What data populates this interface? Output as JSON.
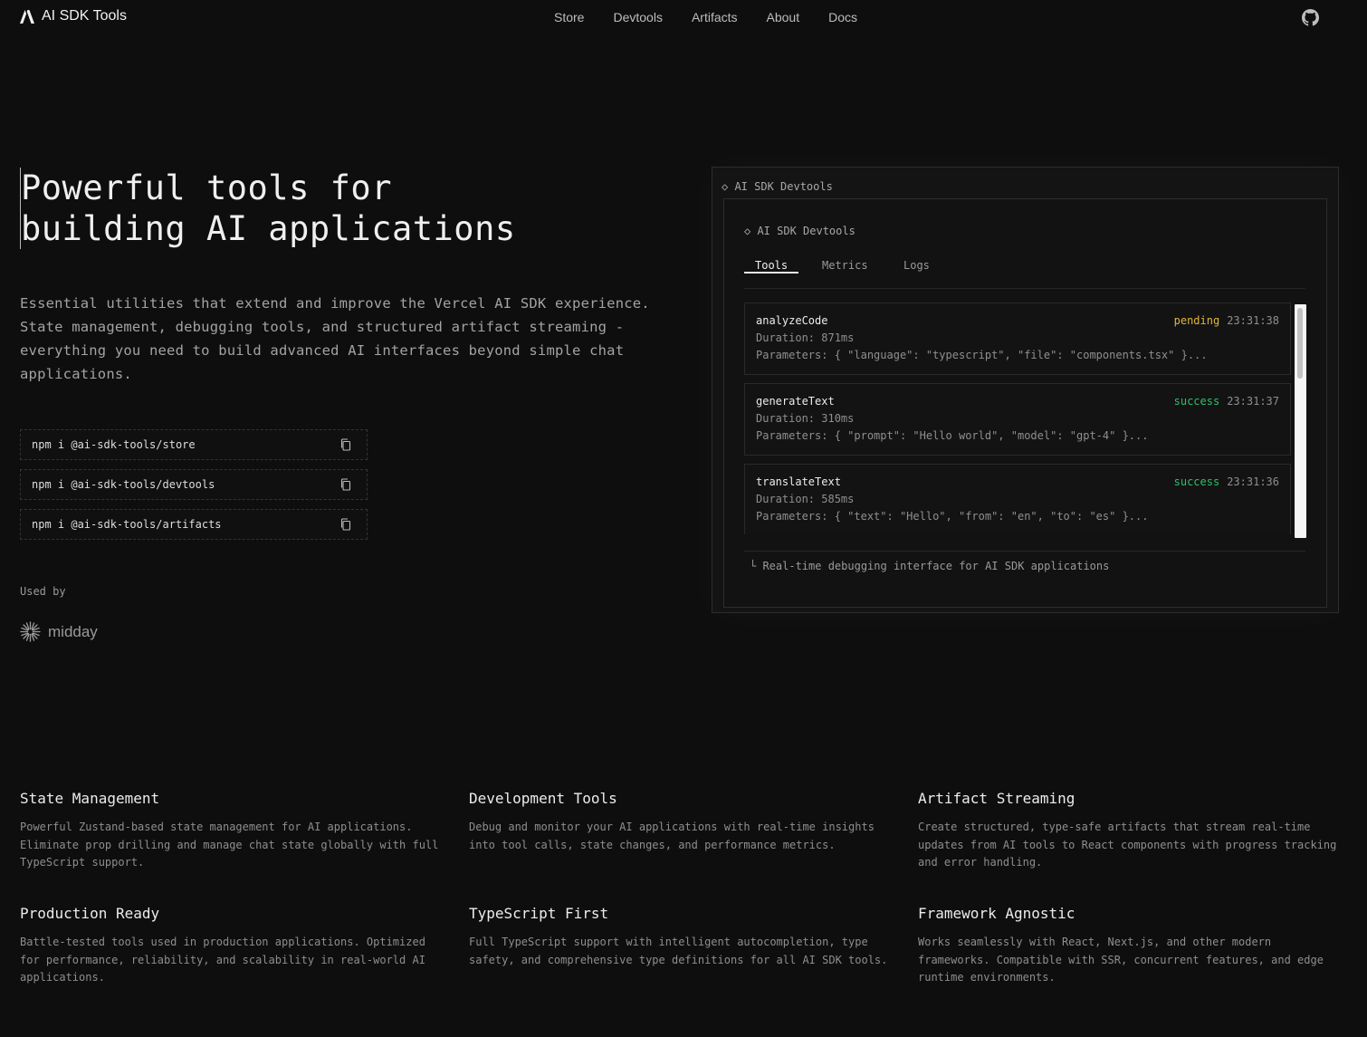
{
  "nav": {
    "brand": "AI SDK Tools",
    "links": [
      "Store",
      "Devtools",
      "Artifacts",
      "About",
      "Docs"
    ],
    "github_icon": "github-icon"
  },
  "hero": {
    "title_line1": "Powerful tools for",
    "title_line2": "building AI applications",
    "description": "Essential utilities that extend and improve the Vercel AI SDK experience. State management, debugging tools, and structured artifact streaming - everything you need to build advanced AI interfaces beyond simple chat applications.",
    "commands": [
      "npm i @ai-sdk-tools/store",
      "npm i @ai-sdk-tools/devtools",
      "npm i @ai-sdk-tools/artifacts"
    ],
    "used_by_label": "Used by",
    "used_by_logo": "midday"
  },
  "devtools_panel": {
    "outer_title": "◇ AI SDK Devtools",
    "inner_title": "◇ AI SDK Devtools",
    "tabs": [
      "Tools",
      "Metrics",
      "Logs"
    ],
    "active_tab": "Tools",
    "cards": [
      {
        "name": "analyzeCode",
        "status": "pending",
        "time": "23:31:38",
        "duration": "Duration: 871ms",
        "parameters": "Parameters: { \"language\": \"typescript\", \"file\": \"components.tsx\" }..."
      },
      {
        "name": "generateText",
        "status": "success",
        "time": "23:31:37",
        "duration": "Duration: 310ms",
        "parameters": "Parameters: { \"prompt\": \"Hello world\", \"model\": \"gpt-4\" }..."
      },
      {
        "name": "translateText",
        "status": "success",
        "time": "23:31:36",
        "duration": "Duration: 585ms",
        "parameters": "Parameters: { \"text\": \"Hello\", \"from\": \"en\", \"to\": \"es\" }..."
      }
    ],
    "footer": "└ Real-time debugging interface for AI SDK applications",
    "colors": {
      "pending": "#e1b63c",
      "success": "#2fbf6a"
    }
  },
  "features": [
    {
      "title": "State Management",
      "desc": "Powerful Zustand-based state management for AI applications. Eliminate prop drilling and manage chat state globally with full TypeScript support."
    },
    {
      "title": "Development Tools",
      "desc": "Debug and monitor your AI applications with real-time insights into tool calls, state changes, and performance metrics."
    },
    {
      "title": "Artifact Streaming",
      "desc": "Create structured, type-safe artifacts that stream real-time updates from AI tools to React components with progress tracking and error handling."
    },
    {
      "title": "Production Ready",
      "desc": "Battle-tested tools used in production applications. Optimized for performance, reliability, and scalability in real-world AI applications."
    },
    {
      "title": "TypeScript First",
      "desc": "Full TypeScript support with intelligent autocompletion, type safety, and comprehensive type definitions for all AI SDK tools."
    },
    {
      "title": "Framework Agnostic",
      "desc": "Works seamlessly with React, Next.js, and other modern frameworks. Compatible with SSR, concurrent features, and edge runtime environments."
    }
  ]
}
